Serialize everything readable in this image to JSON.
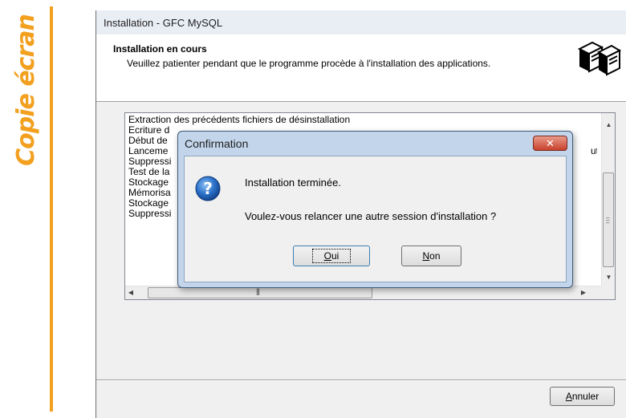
{
  "side_label": "Copie écran",
  "window": {
    "title": "Installation - GFC MySQL",
    "header": {
      "title": "Installation en cours",
      "description": "Veuillez patienter pendant que le programme procède à l'installation des applications."
    },
    "log_lines": [
      "Extraction des précédents fichiers de désinstallation",
      "Ecriture d",
      "Début de",
      "Lanceme",
      "Suppressi",
      "Test de la",
      "Stockage",
      "Mémorisa",
      "Stockage",
      "Suppressi"
    ],
    "log_overflow_text": "utp",
    "cancel_button": {
      "accel": "A",
      "rest": "nnuler"
    }
  },
  "dialog": {
    "title": "Confirmation",
    "close_glyph": "✕",
    "message_line1": "Installation terminée.",
    "message_line2": "Voulez-vous relancer une autre session d'installation ?",
    "yes_button": {
      "accel": "O",
      "rest": "ui"
    },
    "no_button": {
      "accel": "N",
      "rest": "on"
    }
  },
  "colors": {
    "accent_orange": "#f2a01e",
    "dialog_frame": "#c2d5ea",
    "close_red": "#c8412c"
  }
}
